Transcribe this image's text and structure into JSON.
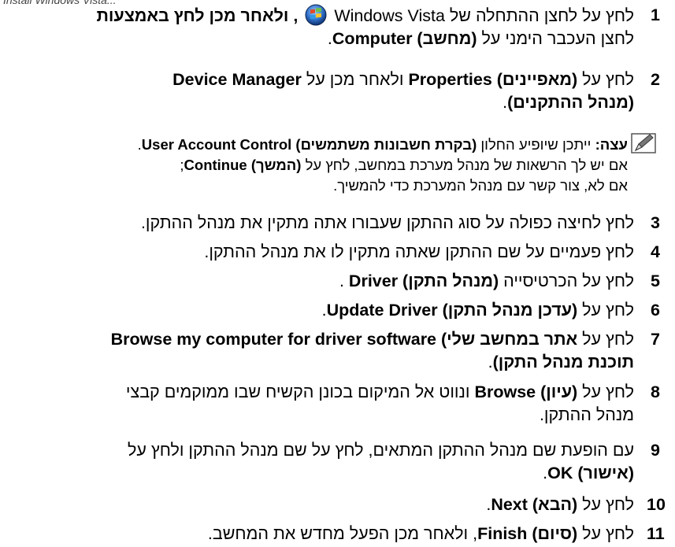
{
  "header_cutoff": "Install Windows Vista...",
  "step1": {
    "num": "1",
    "line1_a": "לחץ על לחצן ההתחלה של",
    "line1_b": "Windows Vista",
    "line1_c": ", ולאחר מכן לחץ באמצעות",
    "line2_a": "לחצן העכבר הימני על",
    "line2_b": "Computer (מחשב)",
    "line2_c": "."
  },
  "step2": {
    "num": "2",
    "a": "לחץ על",
    "b": "Properties (מאפיינים)",
    "c": "ולאחר מכן על",
    "d": "Device Manager",
    "line2_b": "(מנהל ההתקנים)",
    "line2_c": "."
  },
  "tip": {
    "label": "עצה:",
    "l1_a": "ייתכן שיופיע החלון",
    "l1_b": "User Account Control (בקרת חשבונות משתמשים)",
    "l1_c": ".",
    "l2_a": "אם יש לך הרשאות של מנהל מערכת במחשב, לחץ על",
    "l2_b": "Continue (המשך)",
    "l2_c": ";",
    "l3": "אם לא, צור קשר עם מנהל המערכת כדי להמשיך."
  },
  "step3": {
    "num": "3",
    "text": "לחץ לחיצה כפולה על סוג ההתקן שעבורו אתה מתקין את מנהל ההתקן."
  },
  "step4": {
    "num": "4",
    "text": "לחץ פעמיים על שם ההתקן שאתה מתקין לו את מנהל ההתקן."
  },
  "step5": {
    "num": "5",
    "a": "לחץ על הכרטיסייה",
    "b": "Driver (מנהל התקן)",
    "c": "."
  },
  "step6": {
    "num": "6",
    "a": "לחץ על",
    "b": "Update Driver (עדכן מנהל התקן)",
    "c": "."
  },
  "step7": {
    "num": "7",
    "a": "לחץ על",
    "b": "Browse my computer for driver software (אתר במחשב שלי",
    "line2_b": "תוכנת מנהל התקן)",
    "line2_c": "."
  },
  "step8": {
    "num": "8",
    "a": "לחץ על",
    "b": "Browse (עיון)",
    "c": "ונווט אל המיקום בכונן הקשיח שבו ממוקמים קבצי",
    "line2": "מנהל ההתקן."
  },
  "step9": {
    "num": "9",
    "line1": "עם הופעת שם מנהל ההתקן המתאים, לחץ על שם מנהל ההתקן ולחץ על",
    "line2_b": "OK (אישור)",
    "line2_c": "."
  },
  "step10": {
    "num": "10",
    "a": "לחץ על",
    "b": "Next (הבא)",
    "c": "."
  },
  "step11": {
    "num": "11",
    "a": "לחץ על",
    "b": "Finish (סיום)",
    "c": ", ולאחר מכן הפעל מחדש את המחשב."
  },
  "colors": {
    "vista_orb_blue": "#2f6fc8",
    "vista_red": "#e24a2a",
    "vista_green": "#6cc24a",
    "vista_yellow": "#f7c52c"
  }
}
